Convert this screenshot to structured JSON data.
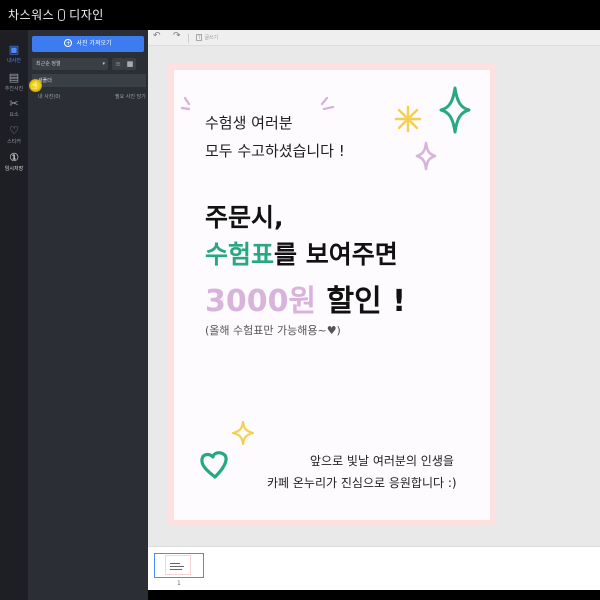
{
  "app": {
    "title_left": "차스워스",
    "title_right": "디자인"
  },
  "rail": {
    "items": [
      {
        "id": "upload",
        "icon": "upload-icon",
        "label": "내사진",
        "active": true
      },
      {
        "id": "text",
        "icon": "text-icon",
        "label": "추진사진"
      },
      {
        "id": "element",
        "icon": "element-icon",
        "label": "요소"
      },
      {
        "id": "sticker",
        "icon": "heart-icon",
        "label": "스티커"
      },
      {
        "id": "save",
        "icon": "save-icon",
        "label": "임시저장"
      }
    ]
  },
  "panel": {
    "upload_button": "사진 가져오기",
    "sort_value": "최근순 정렬",
    "folder_name": "새폴더",
    "sub_item": "내 사진(0)",
    "sub_action": "필요 사진 담기"
  },
  "toolbar": {
    "text_label": "글쓰기"
  },
  "poster": {
    "greeting_line1": "수험생 여러분",
    "greeting_line2": "모두 수고하셨습니다 !",
    "order_line": "주문시,",
    "ticket_highlight": "수험표",
    "ticket_rest": "를 보여주면",
    "discount_amount": "3000원",
    "discount_rest": " 할인 !",
    "note": "(올해 수험표만 가능해용~♥)",
    "closing_line1": "앞으로 빛날 여러분의 인생을",
    "closing_line2": "카페 온누리가 진심으로 응원합니다 :)",
    "colors": {
      "green": "#27a884",
      "lavender": "#d8b4dc",
      "yellow": "#f5cf52",
      "pink_border": "#fde0e0"
    }
  },
  "pages": {
    "current": "1"
  }
}
